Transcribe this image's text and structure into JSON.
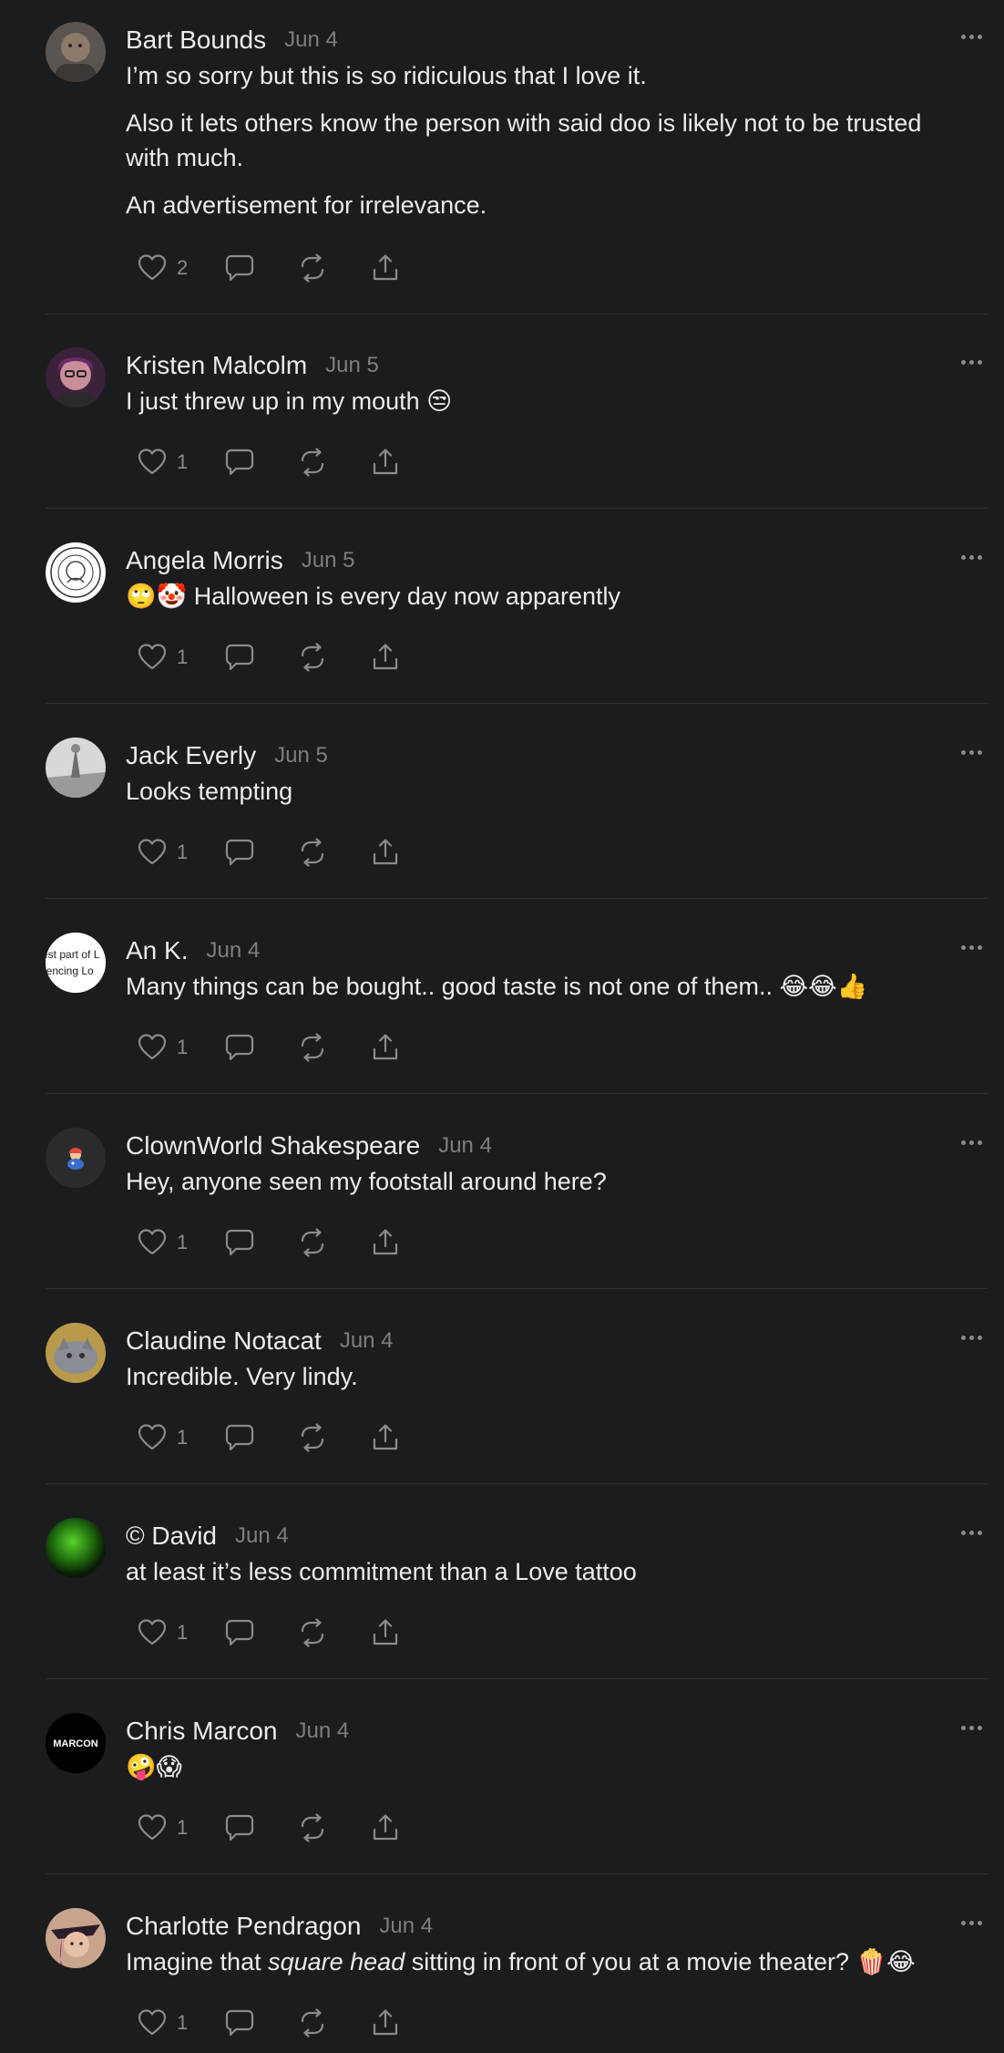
{
  "comments": [
    {
      "author": "Bart Bounds",
      "date": "Jun 4",
      "paragraphs": [
        "I’m so sorry but this is so ridiculous that I love it.",
        "Also it lets others know the person with said doo is likely not to be trusted with much.",
        "An advertisement for irrelevance."
      ],
      "likes": "2",
      "avatar_icon": "person-photo-avatar"
    },
    {
      "author": "Kristen Malcolm",
      "date": "Jun 5",
      "text": "I just threw up in my mouth",
      "emoji": "😒",
      "likes": "1",
      "avatar_icon": "person-photo-avatar"
    },
    {
      "author": "Angela Morris",
      "date": "Jun 5",
      "emoji_prefix": "🙄🤡",
      "text": "Halloween is every day now apparently",
      "likes": "1",
      "avatar_icon": "seal-logo-avatar"
    },
    {
      "author": "Jack Everly",
      "date": "Jun 5",
      "text": "Looks tempting",
      "likes": "1",
      "avatar_icon": "landscape-photo-avatar"
    },
    {
      "author": "An K.",
      "date": "Jun 4",
      "text": "Many things can be bought.. good taste is not one of them..",
      "emoji": "😂😂👍",
      "likes": "1",
      "avatar_text_1": "est part of L",
      "avatar_text_2": "riencing Lo"
    },
    {
      "author": "ClownWorld Shakespeare",
      "date": "Jun 4",
      "text": "Hey, anyone seen my footstall around here?",
      "likes": "1",
      "avatar_icon": "cartoon-avatar"
    },
    {
      "author": "Claudine Notacat",
      "date": "Jun 4",
      "text": "Incredible. Very lindy.",
      "likes": "1",
      "avatar_icon": "cat-photo-avatar"
    },
    {
      "author": "© David",
      "date": "Jun 4",
      "text": "at least it’s less commitment than a Love tattoo",
      "likes": "1",
      "avatar_icon": "green-orb-avatar"
    },
    {
      "author": "Chris Marcon",
      "date": "Jun 4",
      "emoji": "🤪😱",
      "likes": "1",
      "avatar_text": "MARCON"
    },
    {
      "author": "Charlotte Pendragon",
      "date": "Jun 4",
      "text_before": "Imagine that ",
      "text_italic": "square head",
      "text_after": " sitting in front of you at a movie theater?",
      "emoji": "🍿😂",
      "likes": "1",
      "avatar_icon": "person-photo-avatar"
    }
  ],
  "colors": {
    "background": "#1b1c1e",
    "text": "#ececec",
    "muted": "#7d7e82",
    "divider": "#2e2f32"
  },
  "icons": [
    "heart-icon",
    "comment-icon",
    "repost-icon",
    "share-icon",
    "more-icon"
  ]
}
